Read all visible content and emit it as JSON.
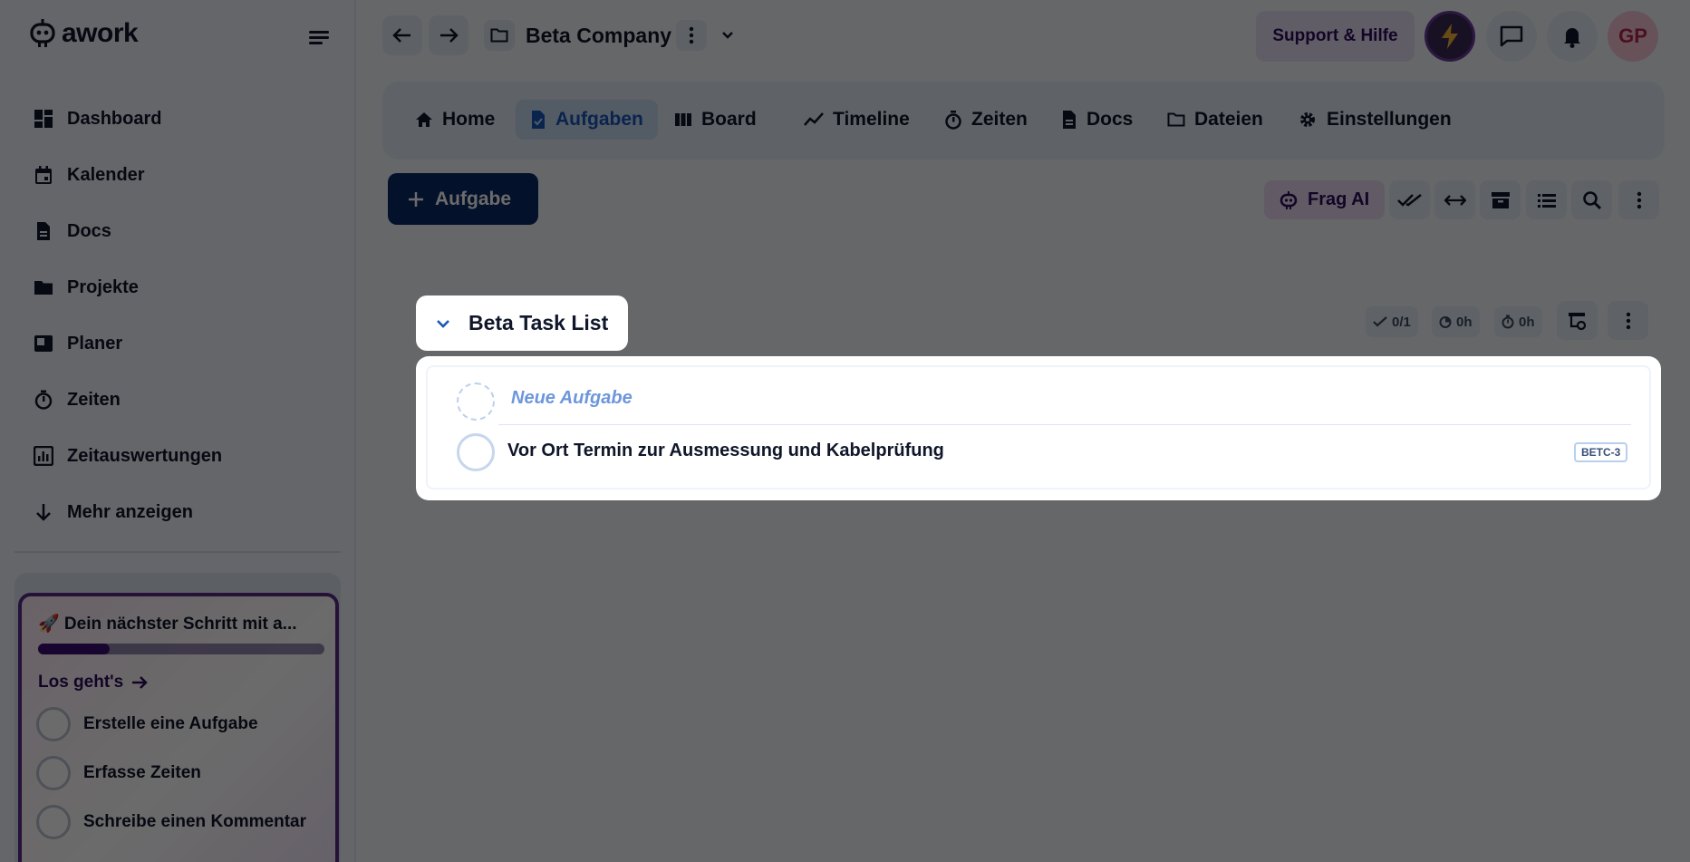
{
  "app": {
    "brand": "awork"
  },
  "sidebar": {
    "items": [
      {
        "label": "Dashboard",
        "icon": "dashboard-icon"
      },
      {
        "label": "Kalender",
        "icon": "calendar-icon"
      },
      {
        "label": "Docs",
        "icon": "doc-icon"
      },
      {
        "label": "Projekte",
        "icon": "folder-icon"
      },
      {
        "label": "Planer",
        "icon": "planner-icon"
      },
      {
        "label": "Zeiten",
        "icon": "timer-icon"
      },
      {
        "label": "Zeitauswertungen",
        "icon": "chart-icon"
      },
      {
        "label": "Mehr anzeigen",
        "icon": "arrow-down-icon"
      }
    ],
    "onboarding": {
      "title": "🚀 Dein nächster Schritt mit a...",
      "progress": 0.25,
      "link": "Los geht's",
      "steps": [
        "Erstelle eine Aufgabe",
        "Erfasse Zeiten",
        "Schreibe einen Kommentar"
      ]
    }
  },
  "header": {
    "project_title": "Beta Company",
    "support_label": "Support & Hilfe",
    "avatar_initials": "GP"
  },
  "tabs": [
    {
      "label": "Home",
      "icon": "home-icon",
      "active": false
    },
    {
      "label": "Aufgaben",
      "icon": "task-doc-icon",
      "active": true
    },
    {
      "label": "Board",
      "icon": "board-icon",
      "active": false
    },
    {
      "label": "Timeline",
      "icon": "timeline-icon",
      "active": false
    },
    {
      "label": "Zeiten",
      "icon": "timer-icon",
      "active": false
    },
    {
      "label": "Docs",
      "icon": "doc-icon",
      "active": false
    },
    {
      "label": "Dateien",
      "icon": "folder-outline-icon",
      "active": false
    },
    {
      "label": "Einstellungen",
      "icon": "gear-icon",
      "active": false
    }
  ],
  "toolbar": {
    "add_task_label": "Aufgabe",
    "ask_ai_label": "Frag AI"
  },
  "task_list": {
    "name": "Beta Task List",
    "stats": {
      "done": "0/1",
      "planned": "0h",
      "tracked": "0h"
    },
    "new_task_placeholder": "Neue Aufgabe",
    "tasks": [
      {
        "title": "Vor Ort Termin zur Ausmessung und Kabelprüfung",
        "key": "BETC-3"
      }
    ]
  },
  "colors": {
    "primary": "#0a2a64",
    "accent": "#1a56b8",
    "ai_purple": "#2d0d5c",
    "overlay": "rgba(0,0,0,0.58)"
  }
}
